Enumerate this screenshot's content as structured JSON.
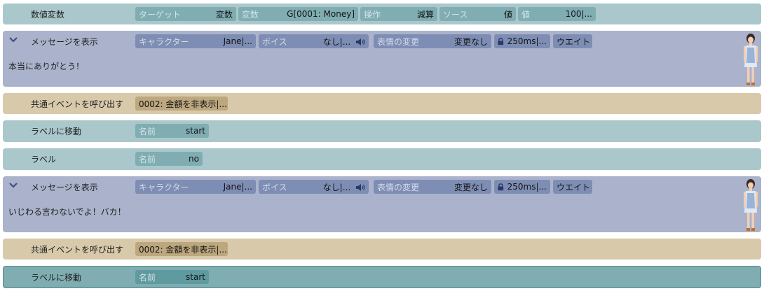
{
  "rows": [
    {
      "type": "var",
      "name": "数値変数",
      "params": [
        {
          "key": "ターゲット",
          "value": "変数"
        },
        {
          "key": "変数",
          "value": "G[0001: Money]"
        },
        {
          "key": "操作",
          "value": "減算"
        },
        {
          "key": "ソース",
          "value": "値"
        },
        {
          "key": "値",
          "value": "100|..."
        }
      ]
    },
    {
      "type": "msg",
      "name": "メッセージを表示",
      "params": [
        {
          "key": "キャラクター",
          "value": "Jane|..."
        },
        {
          "key": "ボイス",
          "value": "なし|..."
        },
        {
          "key": "表情の変更",
          "value": "変更なし"
        },
        {
          "value": "250ms|..."
        },
        {
          "value": "ウエイト"
        }
      ],
      "text": "本当にありがとう！"
    },
    {
      "type": "ce",
      "name": "共通イベントを呼び出す",
      "params": [
        {
          "value": "0002: 金額を非表示|..."
        }
      ]
    },
    {
      "type": "lbl",
      "name": "ラベルに移動",
      "params": [
        {
          "key": "名前",
          "value": "start"
        }
      ]
    },
    {
      "type": "lbl",
      "name": "ラベル",
      "params": [
        {
          "key": "名前",
          "value": "no"
        }
      ]
    },
    {
      "type": "msg",
      "name": "メッセージを表示",
      "params": [
        {
          "key": "キャラクター",
          "value": "Jane|..."
        },
        {
          "key": "ボイス",
          "value": "なし|..."
        },
        {
          "key": "表情の変更",
          "value": "変更なし"
        },
        {
          "value": "250ms|..."
        },
        {
          "value": "ウエイト"
        }
      ],
      "text": "いじわる言わないでよ！バカ！"
    },
    {
      "type": "ce",
      "name": "共通イベントを呼び出す",
      "params": [
        {
          "value": "0002: 金額を非表示|..."
        }
      ]
    },
    {
      "type": "lbl",
      "name": "ラベルに移動",
      "params": [
        {
          "key": "名前",
          "value": "start"
        }
      ],
      "selected": true
    }
  ],
  "colors": {
    "var_row": "#aac7cb",
    "message_row": "#aab3cb",
    "common_event_row": "#d8c9ab",
    "selected_row": "#7fadb2"
  }
}
